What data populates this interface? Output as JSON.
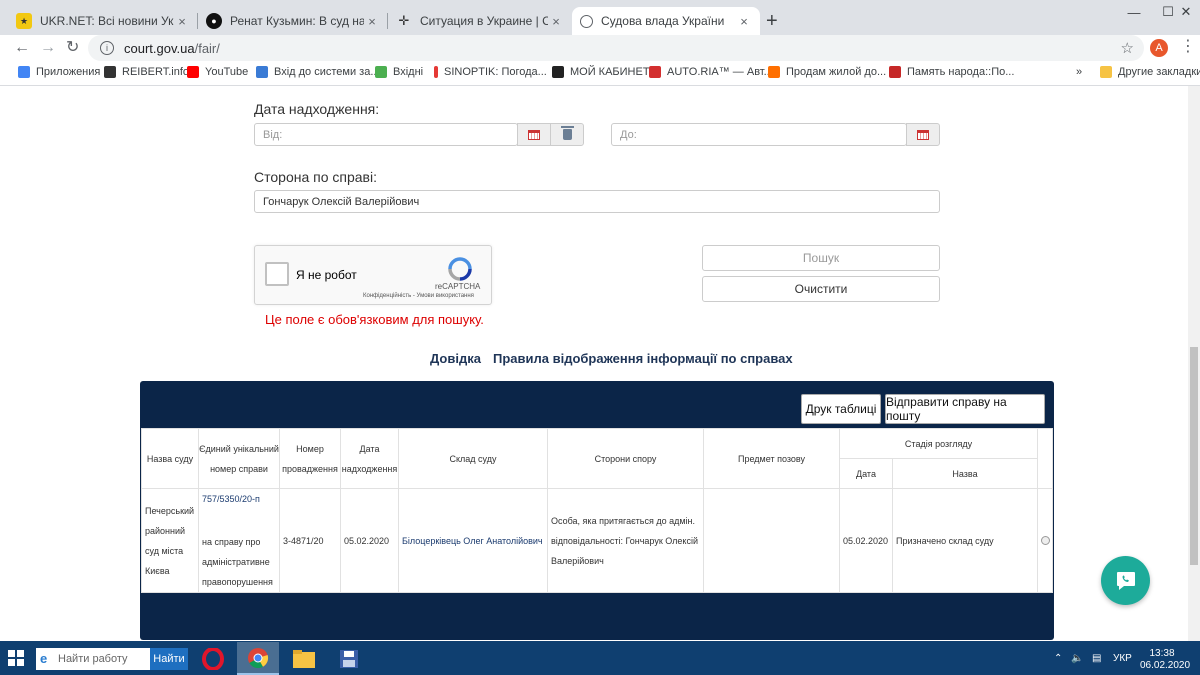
{
  "browser": {
    "tabs": [
      {
        "title": "UKR.NET: Всі новини України, ос",
        "close": "×"
      },
      {
        "title": "Ренат Кузьмин: В суд направлен",
        "close": "×"
      },
      {
        "title": "Ситуация в Украине | Страница",
        "close": "×"
      },
      {
        "title": "Судова влада України",
        "close": "×",
        "active": true
      }
    ],
    "new_tab": "+",
    "window_controls": {
      "minimize": "—",
      "maximize": "☐",
      "close": "✕"
    },
    "nav": {
      "back": "←",
      "forward": "→",
      "reload": "↻"
    },
    "address": {
      "host": "court.gov.ua",
      "path": "/fair/",
      "info": "i",
      "star": "☆"
    },
    "profile_initial": "A",
    "menu": "⋮",
    "bookmarks": [
      {
        "label": "Приложения",
        "color": "#4285f4"
      },
      {
        "label": "REIBERT.info",
        "color": "#333333"
      },
      {
        "label": "YouTube",
        "color": "#ff0000"
      },
      {
        "label": "Вхід до системи за...",
        "color": "#3a7bd5"
      },
      {
        "label": "Вхідні",
        "color": "#4caf50"
      },
      {
        "label": "SINOPTIK: Погода...",
        "color": "#e53935"
      },
      {
        "label": "МОЙ КАБИНЕТ",
        "color": "#222222"
      },
      {
        "label": "AUTO.RIA™ — Авт...",
        "color": "#d32f2f"
      },
      {
        "label": "Продам жилой до...",
        "color": "#ff6f00"
      },
      {
        "label": "Память народа::По...",
        "color": "#c62828"
      }
    ],
    "bookmarks_more": "»",
    "other_bookmarks": "Другие закладки"
  },
  "form": {
    "date_label": "Дата надходження:",
    "date_from_placeholder": "Від:",
    "date_to_placeholder": "До:",
    "party_label": "Сторона по справі:",
    "party_value": "Гончарук Олексій Валерійович",
    "captcha": {
      "label": "Я не робот",
      "brand": "reCAPTCHA",
      "terms": "Конфіденційність - Умови використання"
    },
    "search_button": "Пошук",
    "clear_button": "Очистити",
    "error": "Це поле є обов'язковим для пошуку."
  },
  "links": {
    "help": "Довідка",
    "rules": "Правила відображення інформації по справах"
  },
  "table": {
    "print_button": "Друк таблиці",
    "email_button": "Відправити справу на пошту",
    "headers": {
      "court": "Назва суду",
      "case_number": "Єдиний унікальний номер справи",
      "proceeding_number": "Номер провадження",
      "received_date": "Дата надходження",
      "composition": "Склад суду",
      "parties": "Сторони спору",
      "subject": "Предмет позову",
      "stage": "Стадія розгляду",
      "stage_date": "Дата",
      "stage_name": "Назва"
    },
    "rows": [
      {
        "court": "Печерський районний суд міста Києва",
        "case_number": "757/5350/20-п",
        "case_note": "на справу про адміністративне правопорушення",
        "proceeding_number": "3-4871/20",
        "received_date": "05.02.2020",
        "composition": "Білоцерківець Олег Анатолійович",
        "parties": "Особа, яка притягається до адмін. відповідальності: Гончарук Олексій Валерійович",
        "subject": "",
        "stage_date": "05.02.2020",
        "stage_name": "Призначено склад суду"
      }
    ]
  },
  "taskbar": {
    "search_placeholder": "Найти работу",
    "search_button": "Найти",
    "lang": "УКР",
    "time": "13:38",
    "date": "06.02.2020"
  },
  "colors": {
    "table_header": "#0b2548",
    "error": "#dd0000",
    "chat": "#1dab9a",
    "taskbar": "#0f3f70"
  }
}
